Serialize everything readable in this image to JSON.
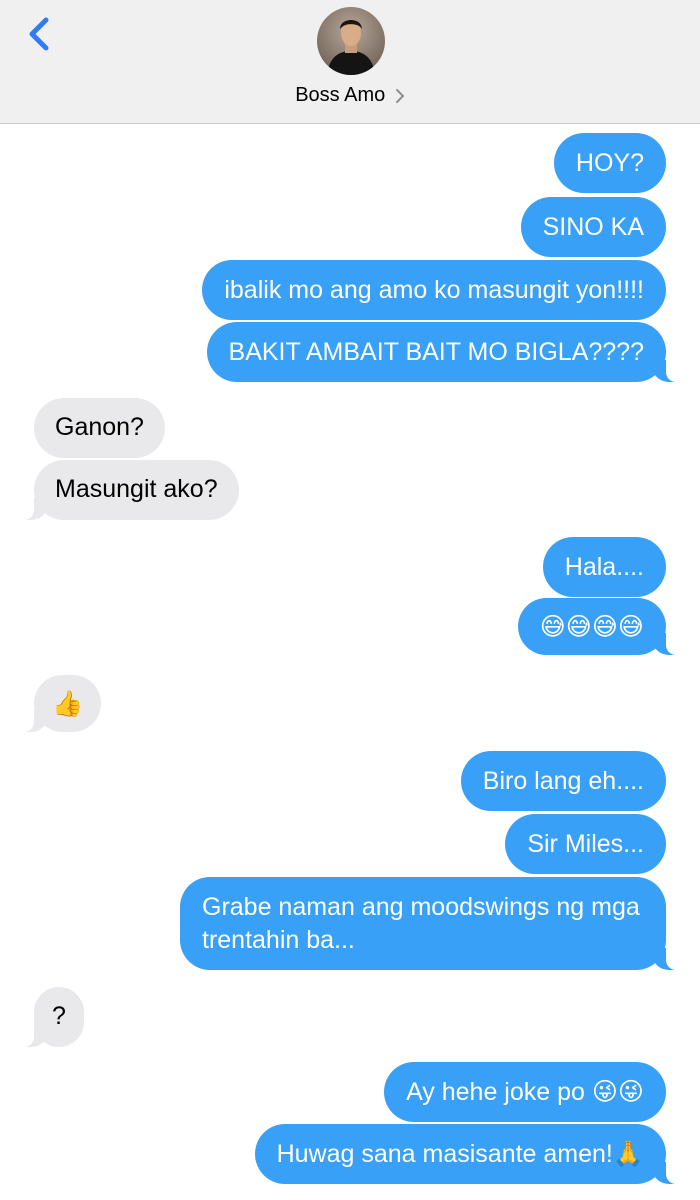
{
  "header": {
    "contact_name": "Boss Amo",
    "back_icon": "chevron-left-icon",
    "accent": "#2f7cf6"
  },
  "messages": [
    {
      "dir": "out",
      "text": "HOY?"
    },
    {
      "dir": "out",
      "text": "SINO KA"
    },
    {
      "dir": "out",
      "text": "ibalik mo ang amo ko masungit yon!!!!"
    },
    {
      "dir": "out",
      "text": "BAKIT AMBAIT BAIT MO BIGLA????"
    },
    {
      "dir": "in",
      "text": "Ganon?"
    },
    {
      "dir": "in",
      "text": "Masungit ako?"
    },
    {
      "dir": "out",
      "text": "Hala...."
    },
    {
      "dir": "out",
      "text": "😅😅😅😅"
    },
    {
      "dir": "in",
      "text": "👍"
    },
    {
      "dir": "out",
      "text": "Biro lang eh...."
    },
    {
      "dir": "out",
      "text": "Sir Miles..."
    },
    {
      "dir": "out",
      "text": "Grabe naman ang moodswings ng mga trentahin ba..."
    },
    {
      "dir": "in",
      "text": "?"
    },
    {
      "dir": "out",
      "text": "Ay hehe joke po 😜😜"
    },
    {
      "dir": "out",
      "text": "Huwag sana masisante amen!🙏"
    }
  ],
  "colors": {
    "outgoing_bubble": "#38a0f6",
    "incoming_bubble": "#e9e9eb",
    "header_bg": "#f0f0f0"
  }
}
